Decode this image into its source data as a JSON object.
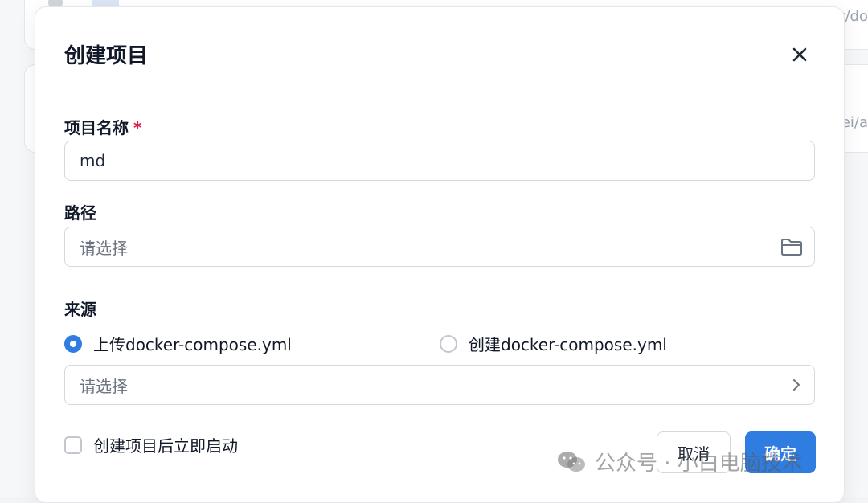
{
  "background": {
    "edge_text_top": "v/do",
    "edge_text_mid": "ei/a"
  },
  "dialog": {
    "title": "创建项目",
    "close_icon": "close-icon"
  },
  "form": {
    "name_label": "项目名称",
    "required_mark": "*",
    "name_value": "md",
    "path_label": "路径",
    "path_placeholder": "请选择",
    "path_icon": "folder-icon",
    "source_label": "来源",
    "source_options": [
      {
        "label": "上传docker-compose.yml",
        "selected": true
      },
      {
        "label": "创建docker-compose.yml",
        "selected": false
      }
    ],
    "file_placeholder": "请选择",
    "file_icon": "chevron-right-icon",
    "autostart_label": "创建项目后立即启动",
    "autostart_checked": false
  },
  "actions": {
    "cancel_label": "取消",
    "confirm_label": "确定"
  },
  "watermark": {
    "text": "公众号 · 小白电脑技术",
    "icon": "wechat-icon"
  },
  "colors": {
    "primary": "#2f7de1",
    "required": "#e11d48",
    "border": "#d4d7de",
    "placeholder": "#6b7280"
  }
}
